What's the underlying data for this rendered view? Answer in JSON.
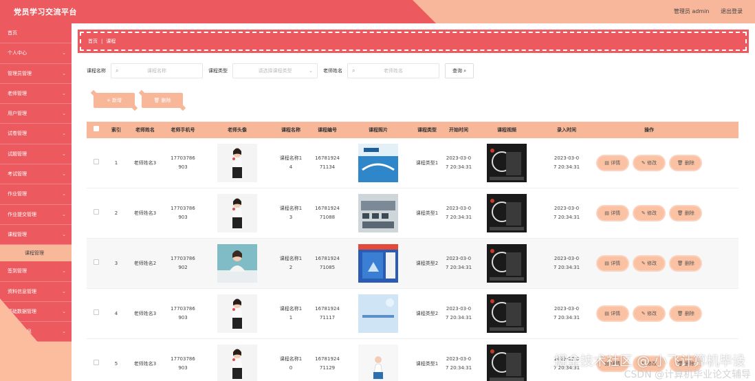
{
  "header": {
    "title": "党员学习交流平台",
    "user_label": "管理员 admin",
    "logout_label": "退出登录"
  },
  "sidebar": {
    "items": [
      {
        "label": "首页",
        "chevron": false
      },
      {
        "label": "个人中心",
        "chevron": true
      },
      {
        "label": "管理员管理",
        "chevron": true
      },
      {
        "label": "老师管理",
        "chevron": true
      },
      {
        "label": "用户管理",
        "chevron": true
      },
      {
        "label": "试卷管理",
        "chevron": true
      },
      {
        "label": "试题管理",
        "chevron": true
      },
      {
        "label": "考试管理",
        "chevron": true
      },
      {
        "label": "作业管理",
        "chevron": true
      },
      {
        "label": "作业提交管理",
        "chevron": true
      },
      {
        "label": "课程管理",
        "chevron": true,
        "expanded": true,
        "sub": "课程管理"
      },
      {
        "label": "签到管理",
        "chevron": true
      },
      {
        "label": "资料信息管理",
        "chevron": true
      },
      {
        "label": "基础数据管理",
        "chevron": true
      },
      {
        "label": "轮播图信息",
        "chevron": true
      }
    ]
  },
  "breadcrumb": {
    "home": "首页",
    "current": "课程"
  },
  "search": {
    "course_name_label": "课程名称",
    "course_name_placeholder": "课程名称",
    "course_type_label": "课程类型",
    "course_type_placeholder": "请选择课程类型",
    "teacher_name_label": "老师姓名",
    "teacher_name_placeholder": "老师姓名",
    "query_label": "查询"
  },
  "actions": {
    "add_label": "新增",
    "delete_label": "删除"
  },
  "table": {
    "headers": [
      "索引",
      "老师姓名",
      "老师手机号",
      "老师头像",
      "课程名称",
      "课程编号",
      "课程照片",
      "课程类型",
      "开始时间",
      "课程视频",
      "录入时间",
      "操作"
    ],
    "rows": [
      {
        "idx": "1",
        "teacher": "老师姓名3",
        "phone": "17703786\n903",
        "course": "课程名称1\n4",
        "code": "16781924\n71134",
        "type": "课程类型1",
        "start": "2023-03-0\n7 20:34:31",
        "entry": "2023-03-0\n7 20:34:31"
      },
      {
        "idx": "2",
        "teacher": "老师姓名3",
        "phone": "17703786\n903",
        "course": "课程名称1\n3",
        "code": "16781924\n71088",
        "type": "课程类型1",
        "start": "2023-03-0\n7 20:34:31",
        "entry": "2023-03-0\n7 20:34:31"
      },
      {
        "idx": "3",
        "teacher": "老师姓名2",
        "phone": "17703786\n902",
        "course": "课程名称1\n2",
        "code": "16781924\n71085",
        "type": "课程类型2",
        "start": "2023-03-0\n7 20:34:31",
        "entry": "2023-03-0\n7 20:34:31"
      },
      {
        "idx": "4",
        "teacher": "老师姓名3",
        "phone": "17703786\n903",
        "course": "课程名称1\n1",
        "code": "16781924\n71117",
        "type": "课程类型2",
        "start": "2023-03-0\n7 20:34:31",
        "entry": "2023-03-0\n7 20:34:31"
      },
      {
        "idx": "5",
        "teacher": "老师姓名3",
        "phone": "17703786\n903",
        "course": "课程名称1\n0",
        "code": "16781924\n71129",
        "type": "课程类型1",
        "start": "2023-03-0\n7 20:34:31",
        "entry": "2023-03-0\n7 20:34:31"
      }
    ],
    "op_detail": "详情",
    "op_edit": "修改",
    "op_delete": "删除"
  },
  "colors": {
    "primary": "#ec5a5f",
    "accent": "#f9b79a"
  },
  "watermark": {
    "line1": "掘金技术社区 @ 小飞计算机毕设",
    "line2": "CSDN @计算机毕业论文辅导"
  }
}
